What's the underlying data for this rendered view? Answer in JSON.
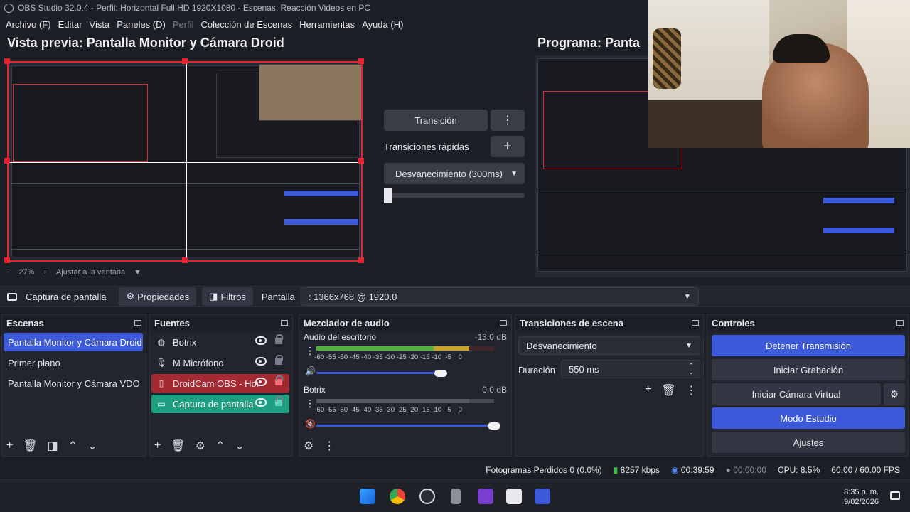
{
  "titlebar": {
    "text": "OBS Studio 32.0.4 - Perfil: Horizontal Full HD 1920X1080 - Escenas: Reacción Videos en PC"
  },
  "menu": [
    "Archivo (F)",
    "Editar",
    "Vista",
    "Paneles (D)",
    "Perfil",
    "Colección de Escenas",
    "Herramientas",
    "Ayuda (H)"
  ],
  "preview": {
    "title": "Vista previa: Pantalla Monitor y Cámara Droid",
    "zoom": "27%",
    "fit_label": "Ajustar a la ventana"
  },
  "program": {
    "title": "Programa: Panta"
  },
  "transition_panel": {
    "transition_label": "Transición",
    "quick_label": "Transiciones rápidas",
    "fade_label": "Desvanecimiento (300ms)"
  },
  "source_toolbar": {
    "source_name": "Captura de pantalla",
    "properties": "Propiedades",
    "filters": "Filtros",
    "screen_label": "Pantalla",
    "screen_value": ": 1366x768 @ 1920.0"
  },
  "scenes": {
    "title": "Escenas",
    "items": [
      "Pantalla Monitor y Cámara Droid",
      "Primer plano",
      "Pantalla Monitor y Cámara VDO"
    ]
  },
  "sources": {
    "title": "Fuentes",
    "items": [
      "Botrix",
      "M Micrófono",
      "DroidCam OBS - Hon",
      "Captura de pantalla"
    ]
  },
  "mixer": {
    "title": "Mezclador de audio",
    "scale": [
      "-60",
      "-55",
      "-50",
      "-45",
      "-40",
      "-35",
      "-30",
      "-25",
      "-20",
      "-15",
      "-10",
      "-5",
      "0"
    ],
    "channels": [
      {
        "name": "Audio del escritorio",
        "db": "-13.0 dB",
        "level": 0.82,
        "volume": 0.7
      },
      {
        "name": "Botrix",
        "db": "0.0 dB",
        "level": 0.0,
        "volume": 1.0
      }
    ]
  },
  "scene_transitions": {
    "title": "Transiciones de escena",
    "selected": "Desvanecimiento",
    "duration_label": "Duración",
    "duration_value": "550 ms"
  },
  "controls": {
    "title": "Controles",
    "stop_stream": "Detener Transmisión",
    "start_record": "Iniciar Grabación",
    "virtual_cam": "Iniciar Cámara Virtual",
    "studio_mode": "Modo Estudio",
    "settings": "Ajustes"
  },
  "status": {
    "dropped_frames": "Fotogramas Perdidos 0 (0.0%)",
    "bitrate": "8257 kbps",
    "stream_time": "00:39:59",
    "record_time": "00:00:00",
    "cpu": "CPU: 8.5%",
    "fps": "60.00 / 60.00 FPS"
  },
  "taskbar": {
    "time": "8:35 p. m.",
    "date": "9/02/2026"
  },
  "colors": {
    "accent": "#3b59d9",
    "live_red": "#e6232f",
    "active_green": "#1f9f82"
  }
}
